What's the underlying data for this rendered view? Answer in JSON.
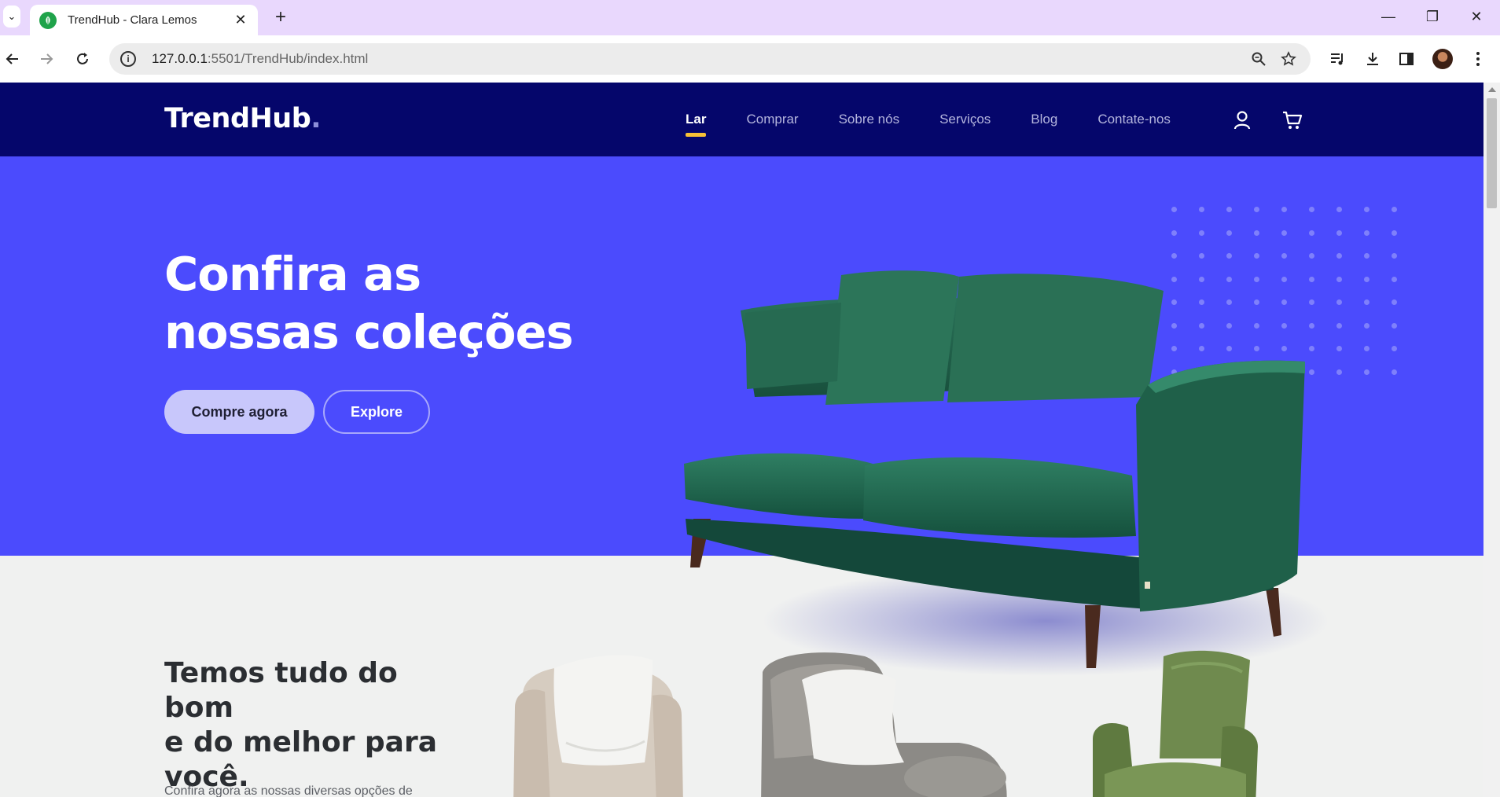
{
  "browser": {
    "tab_title": "TrendHub - Clara Lemos",
    "url_host": "127.0.0.1",
    "url_rest": ":5501/TrendHub/index.html"
  },
  "site": {
    "logo": "TrendHub",
    "logo_dot": ".",
    "nav": [
      "Lar",
      "Comprar",
      "Sobre nós",
      "Serviços",
      "Blog",
      "Contate-nos"
    ],
    "active_nav": "Lar"
  },
  "hero": {
    "title_line1": "Confira as",
    "title_line2": "nossas coleções",
    "primary_button": "Compre agora",
    "secondary_button": "Explore"
  },
  "products": {
    "title_line1": "Temos tudo do bom",
    "title_line2": "e do melhor para",
    "title_line3": "você.",
    "text": "Confira agora as nossas diversas opções de"
  },
  "colors": {
    "header_bg": "#05066b",
    "hero_bg": "#4b4bfd",
    "accent": "#f8c136",
    "tab_strip": "#e9d8fd"
  }
}
